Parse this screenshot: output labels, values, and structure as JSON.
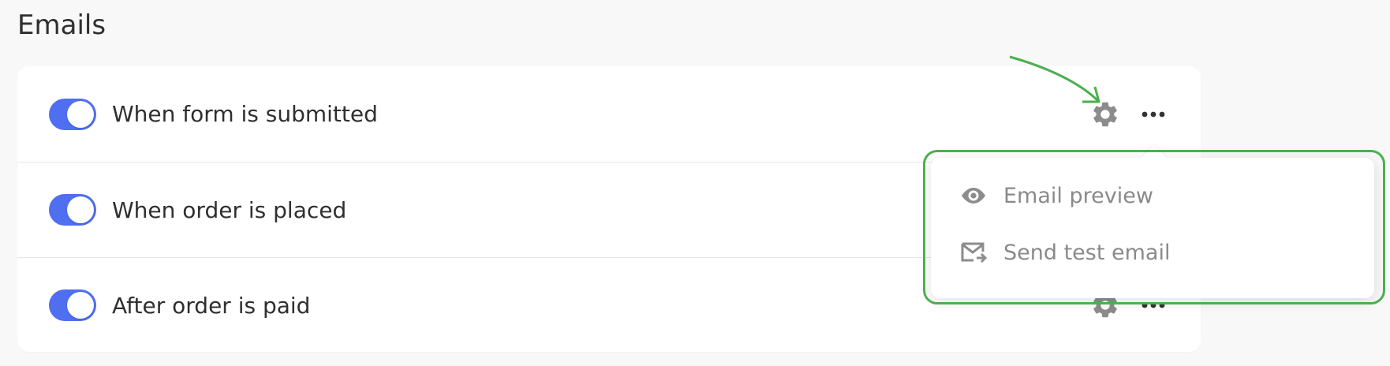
{
  "page": {
    "title": "Emails"
  },
  "colors": {
    "toggle_on": "#4f6ef0",
    "highlight": "#4caf50",
    "menu_text": "#8a8a8a",
    "icon_gray": "#8c8c8c"
  },
  "email_rows": [
    {
      "label": "When form is submitted",
      "enabled": true,
      "icons": [
        "gear-icon",
        "more-icon"
      ]
    },
    {
      "label": "When order is placed",
      "enabled": true,
      "icons": [
        "gear-icon",
        "more-icon"
      ]
    },
    {
      "label": "After order is paid",
      "enabled": true,
      "icons": [
        "gear-icon",
        "more-icon"
      ]
    }
  ],
  "dropdown_menu": {
    "items": [
      {
        "label": "Email preview",
        "icon": "eye-icon"
      },
      {
        "label": "Send test email",
        "icon": "envelope-send-icon"
      }
    ]
  },
  "annotation": {
    "arrow_icon": "arrow-icon",
    "highlight": "highlight-box"
  }
}
